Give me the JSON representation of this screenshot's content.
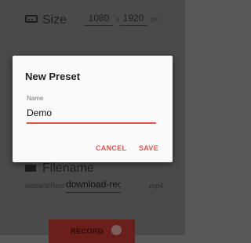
{
  "background": {
    "size": {
      "label": "Size",
      "width": "1080",
      "separator": "x",
      "height": "1920",
      "unit": "px"
    },
    "filename": {
      "label": "Filename",
      "path_prefix": "/sdcard/Rec/",
      "value": "download-rec",
      "extension": ".mp4"
    },
    "record_button": {
      "label": "RECORD"
    }
  },
  "dialog": {
    "title": "New Preset",
    "name_label": "Name",
    "name_value": "Demo",
    "cancel_label": "CANCEL",
    "save_label": "SAVE"
  },
  "colors": {
    "accent": "#e8504a",
    "scrim": "#4a4a4a",
    "record": "#6a1f1a"
  }
}
